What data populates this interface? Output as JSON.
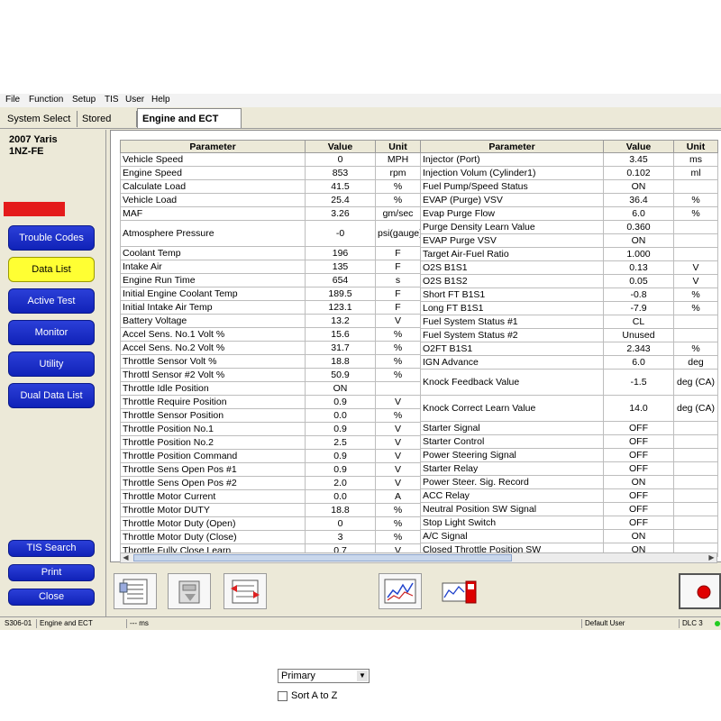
{
  "menu": [
    "File",
    "Function",
    "Setup",
    "TIS",
    "User",
    "Help"
  ],
  "tabs": [
    "System Select",
    "Stored Data",
    "Engine and ECT Live"
  ],
  "vehicle": {
    "model": "2007 Yaris",
    "engine": "1NZ-FE"
  },
  "nav": {
    "trouble_codes": "Trouble Codes",
    "data_list": "Data List",
    "active_test": "Active Test",
    "monitor": "Monitor",
    "utility": "Utility",
    "dual_data_list": "Dual Data List",
    "tis_search": "TIS Search",
    "print": "Print",
    "close": "Close"
  },
  "table_headers": {
    "parameter": "Parameter",
    "value": "Value",
    "unit": "Unit"
  },
  "left_rows": [
    {
      "p": "Vehicle Speed",
      "v": "0",
      "u": "MPH"
    },
    {
      "p": "Engine Speed",
      "v": "853",
      "u": "rpm"
    },
    {
      "p": "Calculate Load",
      "v": "41.5",
      "u": "%"
    },
    {
      "p": "Vehicle Load",
      "v": "25.4",
      "u": "%"
    },
    {
      "p": "MAF",
      "v": "3.26",
      "u": "gm/sec"
    },
    {
      "p": "Atmosphere Pressure",
      "v": "-0",
      "u": "psi(gauge)"
    },
    {
      "p": "Coolant Temp",
      "v": "196",
      "u": "F"
    },
    {
      "p": "Intake Air",
      "v": "135",
      "u": "F"
    },
    {
      "p": "Engine Run Time",
      "v": "654",
      "u": "s"
    },
    {
      "p": "Initial Engine Coolant Temp",
      "v": "189.5",
      "u": "F"
    },
    {
      "p": "Initial Intake Air Temp",
      "v": "123.1",
      "u": "F"
    },
    {
      "p": "Battery Voltage",
      "v": "13.2",
      "u": "V"
    },
    {
      "p": "Accel Sens. No.1 Volt %",
      "v": "15.6",
      "u": "%"
    },
    {
      "p": "Accel Sens. No.2 Volt %",
      "v": "31.7",
      "u": "%"
    },
    {
      "p": "Throttle Sensor Volt %",
      "v": "18.8",
      "u": "%"
    },
    {
      "p": "Throttl Sensor #2 Volt %",
      "v": "50.9",
      "u": "%"
    },
    {
      "p": "Throttle Idle Position",
      "v": "ON",
      "u": ""
    },
    {
      "p": "Throttle Require Position",
      "v": "0.9",
      "u": "V"
    },
    {
      "p": "Throttle Sensor Position",
      "v": "0.0",
      "u": "%"
    },
    {
      "p": "Throttle Position No.1",
      "v": "0.9",
      "u": "V"
    },
    {
      "p": "Throttle Position No.2",
      "v": "2.5",
      "u": "V"
    },
    {
      "p": "Throttle Position Command",
      "v": "0.9",
      "u": "V"
    },
    {
      "p": "Throttle Sens Open Pos #1",
      "v": "0.9",
      "u": "V"
    },
    {
      "p": "Throttle Sens Open Pos #2",
      "v": "2.0",
      "u": "V"
    },
    {
      "p": "Throttle Motor Current",
      "v": "0.0",
      "u": "A"
    },
    {
      "p": "Throttle Motor DUTY",
      "v": "18.8",
      "u": "%"
    },
    {
      "p": "Throttle Motor Duty (Open)",
      "v": "0",
      "u": "%"
    },
    {
      "p": "Throttle Motor Duty (Close)",
      "v": "3",
      "u": "%"
    },
    {
      "p": "Throttle Fully Close Learn",
      "v": "0.7",
      "u": "V"
    }
  ],
  "right_rows": [
    {
      "p": "Injector (Port)",
      "v": "3.45",
      "u": "ms"
    },
    {
      "p": "Injection Volum (Cylinder1)",
      "v": "0.102",
      "u": "ml"
    },
    {
      "p": "Fuel Pump/Speed Status",
      "v": "ON",
      "u": ""
    },
    {
      "p": "EVAP (Purge) VSV",
      "v": "36.4",
      "u": "%"
    },
    {
      "p": "Evap Purge Flow",
      "v": "6.0",
      "u": "%"
    },
    {
      "p": "Purge Density Learn Value",
      "v": "0.360",
      "u": ""
    },
    {
      "p": "EVAP Purge VSV",
      "v": "ON",
      "u": ""
    },
    {
      "p": "Target Air-Fuel Ratio",
      "v": "1.000",
      "u": ""
    },
    {
      "p": "O2S B1S1",
      "v": "0.13",
      "u": "V"
    },
    {
      "p": "O2S B1S2",
      "v": "0.05",
      "u": "V"
    },
    {
      "p": "Short FT B1S1",
      "v": "-0.8",
      "u": "%"
    },
    {
      "p": "Long FT B1S1",
      "v": "-7.9",
      "u": "%"
    },
    {
      "p": "Fuel System Status #1",
      "v": "CL",
      "u": ""
    },
    {
      "p": "Fuel System Status #2",
      "v": "Unused",
      "u": ""
    },
    {
      "p": "O2FT B1S1",
      "v": "2.343",
      "u": "%"
    },
    {
      "p": "IGN Advance",
      "v": "6.0",
      "u": "deg"
    },
    {
      "p": "Knock Feedback Value",
      "v": "-1.5",
      "u": "deg (CA)"
    },
    {
      "p": "Knock Correct Learn Value",
      "v": "14.0",
      "u": "deg (CA)"
    },
    {
      "p": "Starter Signal",
      "v": "OFF",
      "u": ""
    },
    {
      "p": "Starter Control",
      "v": "OFF",
      "u": ""
    },
    {
      "p": "Power Steering Signal",
      "v": "OFF",
      "u": ""
    },
    {
      "p": "Starter Relay",
      "v": "OFF",
      "u": ""
    },
    {
      "p": "Power Steer. Sig. Record",
      "v": "ON",
      "u": ""
    },
    {
      "p": "ACC Relay",
      "v": "OFF",
      "u": ""
    },
    {
      "p": "Neutral Position SW Signal",
      "v": "OFF",
      "u": ""
    },
    {
      "p": "Stop Light Switch",
      "v": "OFF",
      "u": ""
    },
    {
      "p": "A/C Signal",
      "v": "ON",
      "u": ""
    },
    {
      "p": "Closed Throttle Position SW",
      "v": "ON",
      "u": ""
    }
  ],
  "toolbar": {
    "select_value": "Primary",
    "sort_label": "Sort A to Z"
  },
  "status": {
    "code": "S306-01",
    "system": "Engine and ECT",
    "ms": "--- ms",
    "user": "Default User",
    "port": "DLC 3"
  },
  "colors": {
    "nav_blue": "#1e34c8",
    "nav_active": "#ffff33",
    "red_bar": "#e41b1b",
    "record": "#e00000"
  }
}
